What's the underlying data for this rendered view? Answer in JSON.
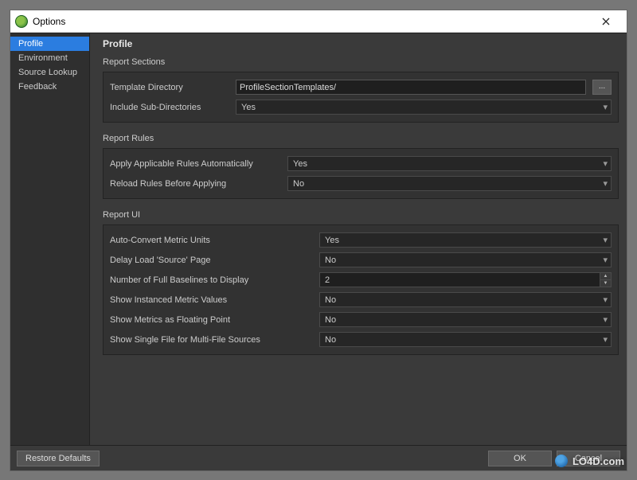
{
  "window": {
    "title": "Options",
    "close_label": "✕"
  },
  "sidebar": {
    "items": [
      {
        "label": "Profile",
        "selected": true
      },
      {
        "label": "Environment"
      },
      {
        "label": "Source Lookup"
      },
      {
        "label": "Feedback"
      }
    ]
  },
  "page": {
    "title": "Profile"
  },
  "sections": {
    "report_sections": {
      "title": "Report Sections",
      "template_dir_label": "Template Directory",
      "template_dir_value": "ProfileSectionTemplates/",
      "browse_label": "...",
      "include_sub_label": "Include Sub-Directories",
      "include_sub_value": "Yes"
    },
    "report_rules": {
      "title": "Report Rules",
      "apply_auto_label": "Apply Applicable Rules Automatically",
      "apply_auto_value": "Yes",
      "reload_label": "Reload Rules Before Applying",
      "reload_value": "No"
    },
    "report_ui": {
      "title": "Report UI",
      "auto_convert_label": "Auto-Convert Metric Units",
      "auto_convert_value": "Yes",
      "delay_load_label": "Delay Load 'Source' Page",
      "delay_load_value": "No",
      "baselines_label": "Number of Full Baselines to Display",
      "baselines_value": "2",
      "instanced_label": "Show Instanced Metric Values",
      "instanced_value": "No",
      "floating_label": "Show Metrics as Floating Point",
      "floating_value": "No",
      "single_file_label": "Show Single File for Multi-File Sources",
      "single_file_value": "No"
    }
  },
  "footer": {
    "restore_label": "Restore Defaults",
    "ok_label": "OK",
    "cancel_label": "Cancel"
  },
  "watermark": {
    "text": "LO4D.com"
  }
}
